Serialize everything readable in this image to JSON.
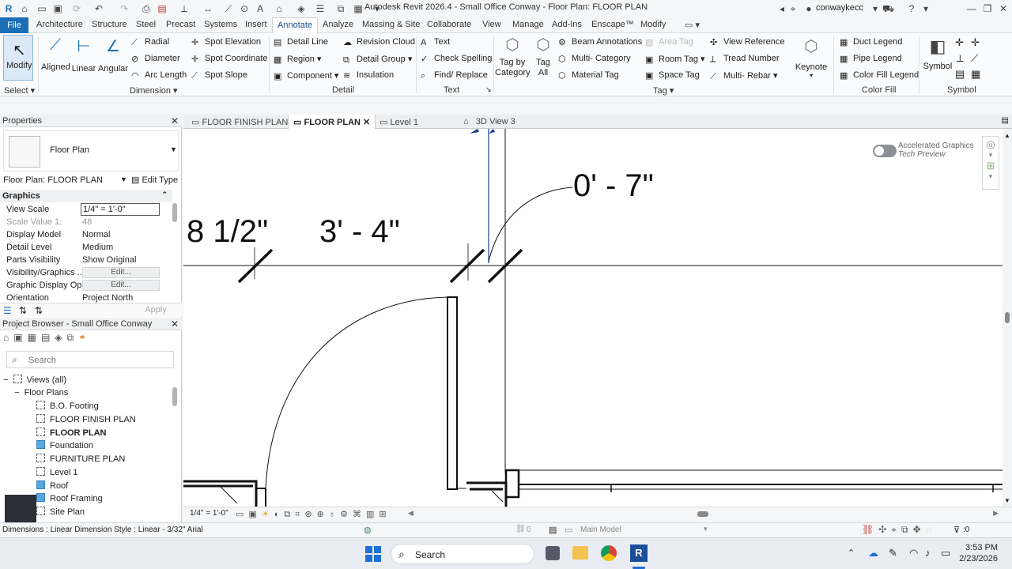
{
  "app": {
    "title": "Autodesk Revit 2026.4 - Small Office Conway - Floor Plan: FLOOR PLAN",
    "user": "conwaykecc"
  },
  "menu": {
    "file": "File",
    "items": [
      "Architecture",
      "Structure",
      "Steel",
      "Precast",
      "Systems",
      "Insert",
      "Annotate",
      "Analyze",
      "Massing & Site",
      "Collaborate",
      "View",
      "Manage",
      "Add-Ins",
      "Enscape™",
      "Modify"
    ],
    "active": "Annotate"
  },
  "ribbon": {
    "select": {
      "modify": "Modify",
      "label": "Select"
    },
    "dimension": {
      "aligned": "Aligned",
      "linear": "Linear",
      "angular": "Angular",
      "radial": "Radial",
      "diameter": "Diameter",
      "arc_length": "Arc  Length",
      "spot_elevation": "Spot  Elevation",
      "spot_coordinate": "Spot  Coordinate",
      "spot_slope": "Spot  Slope",
      "label": "Dimension"
    },
    "detail": {
      "detail_line": "Detail  Line",
      "region": "Region",
      "component": "Component",
      "revision_cloud": "Revision  Cloud",
      "detail_group": "Detail  Group",
      "insulation": "Insulation",
      "label": "Detail"
    },
    "text": {
      "text": "Text",
      "check_spelling": "Check  Spelling",
      "find_replace": "Find/  Replace",
      "label": "Text"
    },
    "tag": {
      "tag_by_category": "Tag by Category",
      "tag_all": "Tag All",
      "beam_annotations": "Beam  Annotations",
      "multi_category": "Multi- Category",
      "material_tag": "Material  Tag",
      "area_tag": "Area  Tag",
      "room_tag": "Room  Tag",
      "space_tag": "Space  Tag",
      "view_reference": "View  Reference",
      "tread_number": "Tread  Number",
      "multi_rebar": "Multi- Rebar",
      "keynote": "Keynote",
      "label": "Tag"
    },
    "color_fill": {
      "duct_legend": "Duct  Legend",
      "pipe_legend": "Pipe  Legend",
      "color_fill_legend": "Color Fill  Legend",
      "label": "Color Fill"
    },
    "symbol": {
      "symbol": "Symbol",
      "label": "Symbol"
    }
  },
  "properties": {
    "title": "Properties",
    "type_name": "Floor Plan",
    "instance_selector": "Floor Plan: FLOOR PLAN",
    "edit_type": "Edit Type",
    "section": "Graphics",
    "rows": [
      {
        "key": "View Scale",
        "value": "1/4\" = 1'-0\""
      },
      {
        "key": "Scale Value    1:",
        "value": "48"
      },
      {
        "key": "Display Model",
        "value": "Normal"
      },
      {
        "key": "Detail Level",
        "value": "Medium"
      },
      {
        "key": "Parts Visibility",
        "value": "Show Original"
      },
      {
        "key": "Visibility/Graphics ...",
        "value": "Edit..."
      },
      {
        "key": "Graphic Display Op...",
        "value": "Edit..."
      },
      {
        "key": "Orientation",
        "value": "Project North"
      }
    ],
    "apply": "Apply"
  },
  "browser": {
    "title": "Project Browser - Small Office Conway",
    "search_placeholder": "Search",
    "root": "Views (all)",
    "group": "Floor Plans",
    "items": [
      "B.O. Footing",
      "FLOOR FINISH PLAN",
      "FLOOR PLAN",
      "Foundation",
      "FURNITURE PLAN",
      "Level 1",
      "Roof",
      "Roof Framing",
      "Site Plan"
    ],
    "active": "FLOOR PLAN"
  },
  "tabs": [
    "FLOOR FINISH PLAN",
    "FLOOR PLAN",
    "Level 1",
    "3D View 3"
  ],
  "canvas": {
    "accel_title": "Accelerated Graphics",
    "accel_sub": "Tech Preview",
    "dims": [
      "0' - 7\"",
      "8 1/2\"",
      "3' - 4\""
    ]
  },
  "viewbar": {
    "scale": "1/4\" = 1'-0\""
  },
  "status": {
    "text": "Dimensions : Linear Dimension Style : Linear - 3/32\" Arial",
    "count": "0",
    "model": "Main Model",
    "filter": ":0"
  },
  "taskbar": {
    "search": "Search",
    "time": "3:53 PM",
    "date": "2/23/2026"
  }
}
